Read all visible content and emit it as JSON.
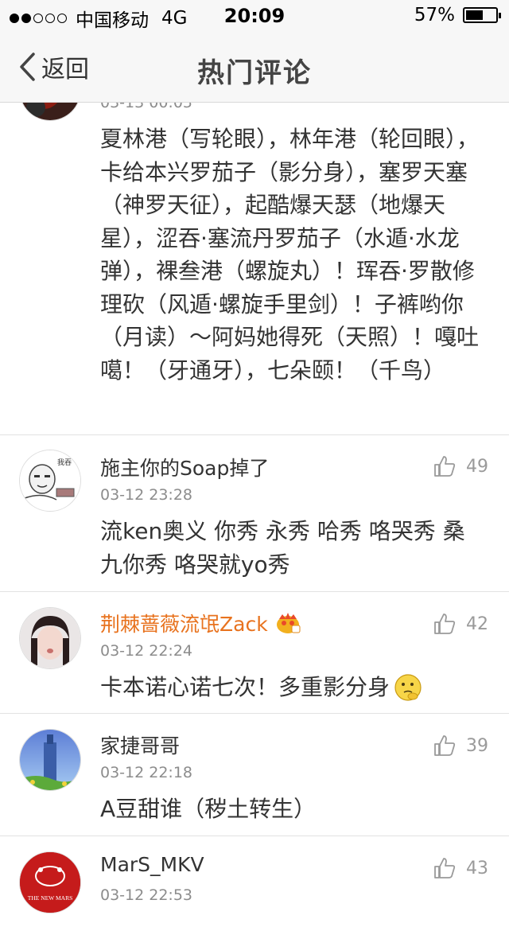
{
  "status_bar": {
    "carrier": "中国移动",
    "network": "4G",
    "time": "20:09",
    "battery": "57%",
    "battery_level": 0.57
  },
  "nav": {
    "back_label": "返回",
    "title": "热门评论"
  },
  "comments": [
    {
      "time": "03-13 00:05",
      "text": "夏林港（写轮眼），林年港（轮回眼），卡给本兴罗茄子（影分身），塞罗天塞（神罗天征），起酷爆天瑟（地爆天星），涩吞·塞流丹罗茄子（水遁·水龙弹），裸叁港（螺旋丸）！珲吞·罗散修理砍（风遁·螺旋手里剑）！子裤哟你（月读）～阿妈她得死（天照）！嘎吐噶！（牙通牙），七朵颐！（千鸟）"
    },
    {
      "name": "施主你的Soap掉了",
      "time": "03-12 23:28",
      "likes": "49",
      "text": "流ken奥义 你秀 永秀 哈秀 咯哭秀 桑九你秀 咯哭就yo秀",
      "avatar_text": "我吞"
    },
    {
      "name": "荆棘蔷薇流氓Zack",
      "time": "03-12 22:24",
      "likes": "42",
      "text": "卡本诺心诺七次！多重影分身"
    },
    {
      "name": "家捷哥哥",
      "time": "03-12 22:18",
      "likes": "39",
      "text": "A豆甜谁（秽土转生）"
    },
    {
      "name": "MarS_MKV",
      "time": "03-12 22:53",
      "likes": "43",
      "avatar_text": "THE NEW MARS"
    }
  ],
  "colors": {
    "vip_name": "#e8731f",
    "meta_gray": "#8c8c8c",
    "nav_bg": "#f7f7f7"
  },
  "icons": [
    "back-chevron-icon",
    "thumb-up-icon",
    "vip-crown-icon",
    "thinking-emoji-icon"
  ]
}
